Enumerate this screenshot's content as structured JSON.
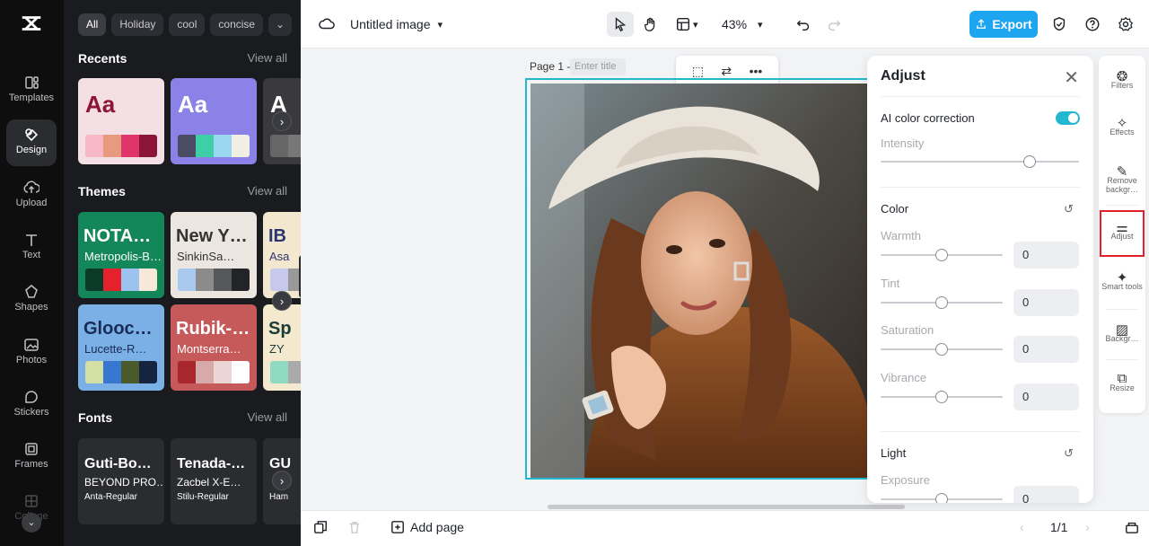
{
  "rail": {
    "items": [
      {
        "label": "Templates",
        "icon": "templates-icon"
      },
      {
        "label": "Design",
        "icon": "design-icon",
        "active": true
      },
      {
        "label": "Upload",
        "icon": "upload-icon"
      },
      {
        "label": "Text",
        "icon": "text-icon"
      },
      {
        "label": "Shapes",
        "icon": "shapes-icon"
      },
      {
        "label": "Photos",
        "icon": "photos-icon"
      },
      {
        "label": "Stickers",
        "icon": "stickers-icon"
      },
      {
        "label": "Frames",
        "icon": "frames-icon"
      },
      {
        "label": "Collage",
        "icon": "collage-icon"
      }
    ]
  },
  "panel": {
    "chips": [
      "All",
      "Holiday",
      "cool",
      "concise"
    ],
    "recents": {
      "title": "Recents",
      "view_all": "View all",
      "cards": [
        {
          "aa": "Aa",
          "bg": "#f4dfe4",
          "fg": "#8b1538",
          "swatches": [
            "#f7b7c4",
            "#e89a7e",
            "#e0356b",
            "#8b1538"
          ]
        },
        {
          "aa": "Aa",
          "bg": "#8b82e8",
          "fg": "#ffffff",
          "swatches": [
            "#4b4b66",
            "#3ecfa8",
            "#9ad8f2",
            "#f1efe3"
          ]
        },
        {
          "aa": "A",
          "bg": "#3a3a3e",
          "fg": "#ffffff",
          "swatches": [
            "#666",
            "#777",
            "#888",
            "#999"
          ]
        }
      ]
    },
    "themes": {
      "title": "Themes",
      "view_all": "View all",
      "cards": [
        {
          "t1": "NOTA…",
          "t2": "Metropolis-B…",
          "bg": "#14875a",
          "fg": "#ffffff",
          "swatches": [
            "#0b3b28",
            "#e5212b",
            "#9cc2f0",
            "#f7e8d8"
          ]
        },
        {
          "t1": "New Y…",
          "t2": "SinkinSa…",
          "bg": "#ebe6df",
          "fg": "#333333",
          "swatches": [
            "#a9c8ee",
            "#8b8b8b",
            "#55575b",
            "#222428"
          ]
        },
        {
          "t1": "IB",
          "t2": "Asa",
          "bg": "#f3e8cf",
          "fg": "#2a3570",
          "swatches": [
            "#c6c9ec",
            "#999",
            "#777",
            "#555"
          ]
        },
        {
          "t1": "Glooc…",
          "t2": "Lucette-R…",
          "bg": "#7ab0e6",
          "fg": "#1a2b55",
          "swatches": [
            "#d3dfa5",
            "#3877d0",
            "#4a5a2b",
            "#16253f"
          ]
        },
        {
          "t1": "Rubik-…",
          "t2": "Montserra…",
          "bg": "#c65a5a",
          "fg": "#ffffff",
          "swatches": [
            "#a8272d",
            "#d7a9a9",
            "#ecd5d5",
            "#ffffff"
          ]
        },
        {
          "t1": "Sp",
          "t2": "ZY",
          "bg": "#f4e9cf",
          "fg": "#1b3b36",
          "swatches": [
            "#8fdac0",
            "#aaa",
            "#888",
            "#666"
          ]
        }
      ]
    },
    "fonts": {
      "title": "Fonts",
      "view_all": "View all",
      "cards": [
        {
          "f1": "Guti-Bo…",
          "f2": "BEYOND PRO…",
          "f3": "Anta-Regular"
        },
        {
          "f1": "Tenada-…",
          "f2": "Zacbel X-E…",
          "f3": "Stilu-Regular"
        },
        {
          "f1": "GU",
          "f2": "",
          "f3": "Ham"
        }
      ]
    }
  },
  "topbar": {
    "doc_title": "Untitled image",
    "zoom": "43%",
    "export_label": "Export"
  },
  "canvas": {
    "page_label": "Page 1 -",
    "title_placeholder": "Enter title"
  },
  "adjust": {
    "title": "Adjust",
    "ai_label": "AI color correction",
    "ai_enabled": true,
    "intensity_label": "Intensity",
    "intensity_value": 0.75,
    "color_label": "Color",
    "color_sliders": [
      {
        "label": "Warmth",
        "value": "0"
      },
      {
        "label": "Tint",
        "value": "0"
      },
      {
        "label": "Saturation",
        "value": "0"
      },
      {
        "label": "Vibrance",
        "value": "0"
      }
    ],
    "light_label": "Light",
    "light_sliders": [
      {
        "label": "Exposure",
        "value": "0"
      }
    ]
  },
  "tools": [
    {
      "label": "Filters",
      "icon": "filters-icon"
    },
    {
      "label": "Effects",
      "icon": "effects-icon"
    },
    {
      "label": "Remove backgr…",
      "icon": "remove-background-icon"
    },
    {
      "label": "Adjust",
      "icon": "adjust-icon",
      "active": true
    },
    {
      "label": "Smart tools",
      "icon": "smart-tools-icon"
    },
    {
      "label": "Backgr…",
      "icon": "background-icon"
    },
    {
      "label": "Resize",
      "icon": "resize-icon"
    }
  ],
  "bottombar": {
    "add_page": "Add page",
    "page_count": "1/1"
  },
  "colors": {
    "accent": "#22b8cf",
    "export": "#1ea5f0",
    "highlight": "#e0212b"
  }
}
